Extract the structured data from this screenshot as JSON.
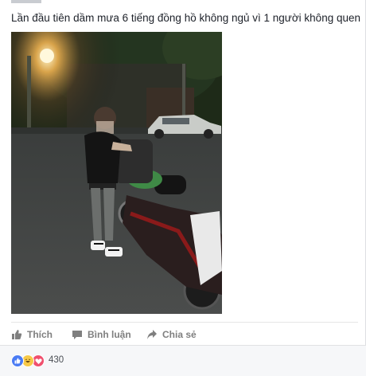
{
  "post": {
    "text": "Lần đầu tiên dầm mưa 6 tiếng đồng hồ không ngủ vì 1 người không quen"
  },
  "actions": {
    "like_label": "Thích",
    "comment_label": "Bình luận",
    "share_label": "Chia sẻ"
  },
  "reactions": {
    "count": "430",
    "types": [
      "like-icon",
      "haha-icon",
      "love-icon"
    ]
  },
  "colors": {
    "action_text": "#7f7f7f",
    "like_blue": "#4a7bf4",
    "love_red": "#f0506e",
    "haha_yellow": "#f7c948"
  }
}
